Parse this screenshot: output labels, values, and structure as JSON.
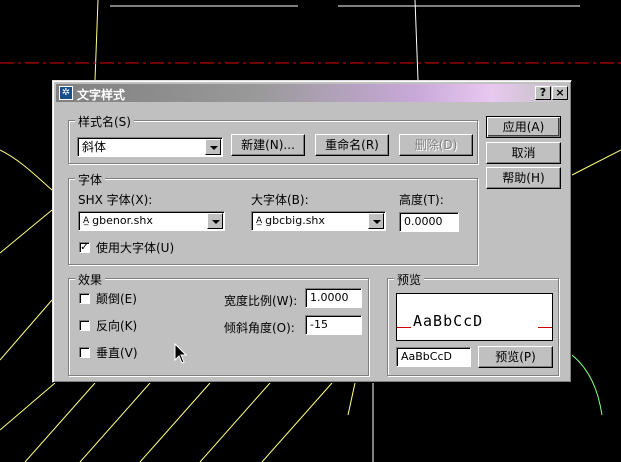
{
  "dialog": {
    "title": "文字样式",
    "help_btn": "?",
    "close_btn": "×"
  },
  "style_name": {
    "group_label": "样式名(S)",
    "selected": "斜体",
    "new_btn": "新建(N)...",
    "rename_btn": "重命名(R)",
    "delete_btn": "删除(D)"
  },
  "side_buttons": {
    "apply": "应用(A)",
    "cancel": "取消",
    "help": "帮助(H)"
  },
  "font": {
    "group_label": "字体",
    "shx_label": "SHX 字体(X):",
    "shx_value": "gbenor.shx",
    "big_label": "大字体(B):",
    "big_value": "gbcbig.shx",
    "height_label": "高度(T):",
    "height_value": "0.0000",
    "use_big_label": "使用大字体(U)",
    "use_big_checked": true,
    "font_icon": "A-font-icon"
  },
  "effects": {
    "group_label": "效果",
    "upside_down": "颠倒(E)",
    "backwards": "反向(K)",
    "vertical": "垂直(V)",
    "width_label": "宽度比例(W):",
    "width_value": "1.0000",
    "oblique_label": "倾斜角度(O):",
    "oblique_value": "-15"
  },
  "preview": {
    "group_label": "预览",
    "sample_text": "AaBbCcD",
    "input_value": "AaBbCcD",
    "preview_btn": "预览(P)"
  }
}
